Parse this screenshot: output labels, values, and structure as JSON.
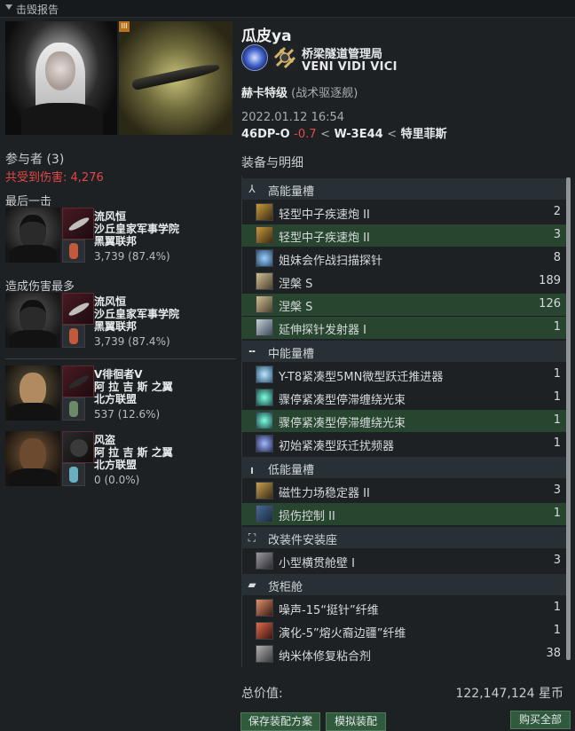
{
  "window": {
    "title": "击毁报告"
  },
  "victim": {
    "name": "瓜皮ya",
    "corporation": "桥梁隧道管理局",
    "alliance": "VENI VIDI VICI",
    "ship_name": "赫卡特级",
    "ship_class": "(战术驱逐舰)",
    "time": "2022.01.12 16:54",
    "location": {
      "system": "46DP-O",
      "security": "-0.7",
      "sep1": "<",
      "constellation": "W-3E44",
      "sep2": "<",
      "region": "特里菲斯"
    }
  },
  "participants": {
    "title": "参与者 (3)",
    "total_damage_label": "共受到伤害:",
    "total_damage": "4,276",
    "final_blow_label": "最后一击",
    "top_damage_label": "造成伤害最多",
    "final_blow": {
      "name": "流风恒",
      "corp": "沙丘皇家军事学院",
      "alliance": "黑翼联邦",
      "damage": "3,739 (87.4%)"
    },
    "top_damage": {
      "name": "流风恒",
      "corp": "沙丘皇家军事学院",
      "alliance": "黑翼联邦",
      "damage": "3,739 (87.4%)"
    },
    "others": [
      {
        "name": "V徘徊者V",
        "corp": "阿 拉 吉 斯 之翼",
        "alliance": "北方联盟",
        "damage": "537 (12.6%)"
      },
      {
        "name": "风盗",
        "corp": "阿 拉 吉 斯 之翼",
        "alliance": "北方联盟",
        "damage": "0 (0.0%)"
      }
    ]
  },
  "fitting": {
    "title": "装备与明细",
    "groups": [
      {
        "label": "高能量槽",
        "icon": "high-slot-icon"
      },
      {
        "label": "中能量槽",
        "icon": "mid-slot-icon"
      },
      {
        "label": "低能量槽",
        "icon": "low-slot-icon"
      },
      {
        "label": "改装件安装座",
        "icon": "rig-slot-icon"
      },
      {
        "label": "货柜舱",
        "icon": "cargo-icon"
      }
    ],
    "items": [
      {
        "label": "轻型中子疾速炮 II",
        "qty": "2",
        "highlight": false,
        "group": 0
      },
      {
        "label": "轻型中子疾速炮 II",
        "qty": "3",
        "highlight": true,
        "group": 0
      },
      {
        "label": "姐妹会作战扫描探针",
        "qty": "8",
        "highlight": false,
        "group": 0
      },
      {
        "label": "涅槃 S",
        "qty": "189",
        "highlight": false,
        "group": 0
      },
      {
        "label": "涅槃 S",
        "qty": "126",
        "highlight": true,
        "group": 0
      },
      {
        "label": "延伸探针发射器 I",
        "qty": "1",
        "highlight": true,
        "group": 0
      },
      {
        "label": "Y-T8紧凑型5MN微型跃迁推进器",
        "qty": "1",
        "highlight": false,
        "group": 1
      },
      {
        "label": "骤停紧凑型停滞缠绕光束",
        "qty": "1",
        "highlight": false,
        "group": 1
      },
      {
        "label": "骤停紧凑型停滞缠绕光束",
        "qty": "1",
        "highlight": true,
        "group": 1
      },
      {
        "label": "初始紧凑型跃迁扰频器",
        "qty": "1",
        "highlight": false,
        "group": 1
      },
      {
        "label": "磁性力场稳定器 II",
        "qty": "3",
        "highlight": false,
        "group": 2
      },
      {
        "label": "损伤控制 II",
        "qty": "1",
        "highlight": true,
        "group": 2
      },
      {
        "label": "小型横贯舱壁 I",
        "qty": "3",
        "highlight": false,
        "group": 3
      },
      {
        "label": "噪声-15“挺针”纤维",
        "qty": "1",
        "highlight": false,
        "group": 4
      },
      {
        "label": "演化-5”熔火裔边疆”纤维",
        "qty": "1",
        "highlight": false,
        "group": 4
      },
      {
        "label": "纳米体修复粘合剂",
        "qty": "38",
        "highlight": false,
        "group": 4
      }
    ]
  },
  "footer": {
    "total_label": "总价值:",
    "total_value": "122,147,124 星币",
    "save_fit_label": "保存装配方案",
    "simulate_label": "模拟装配",
    "buy_all_label": "购买全部"
  },
  "colors": {
    "highlight_row": "#27452f",
    "damage_red": "#e64646",
    "button_green": "#2f5a3c"
  }
}
